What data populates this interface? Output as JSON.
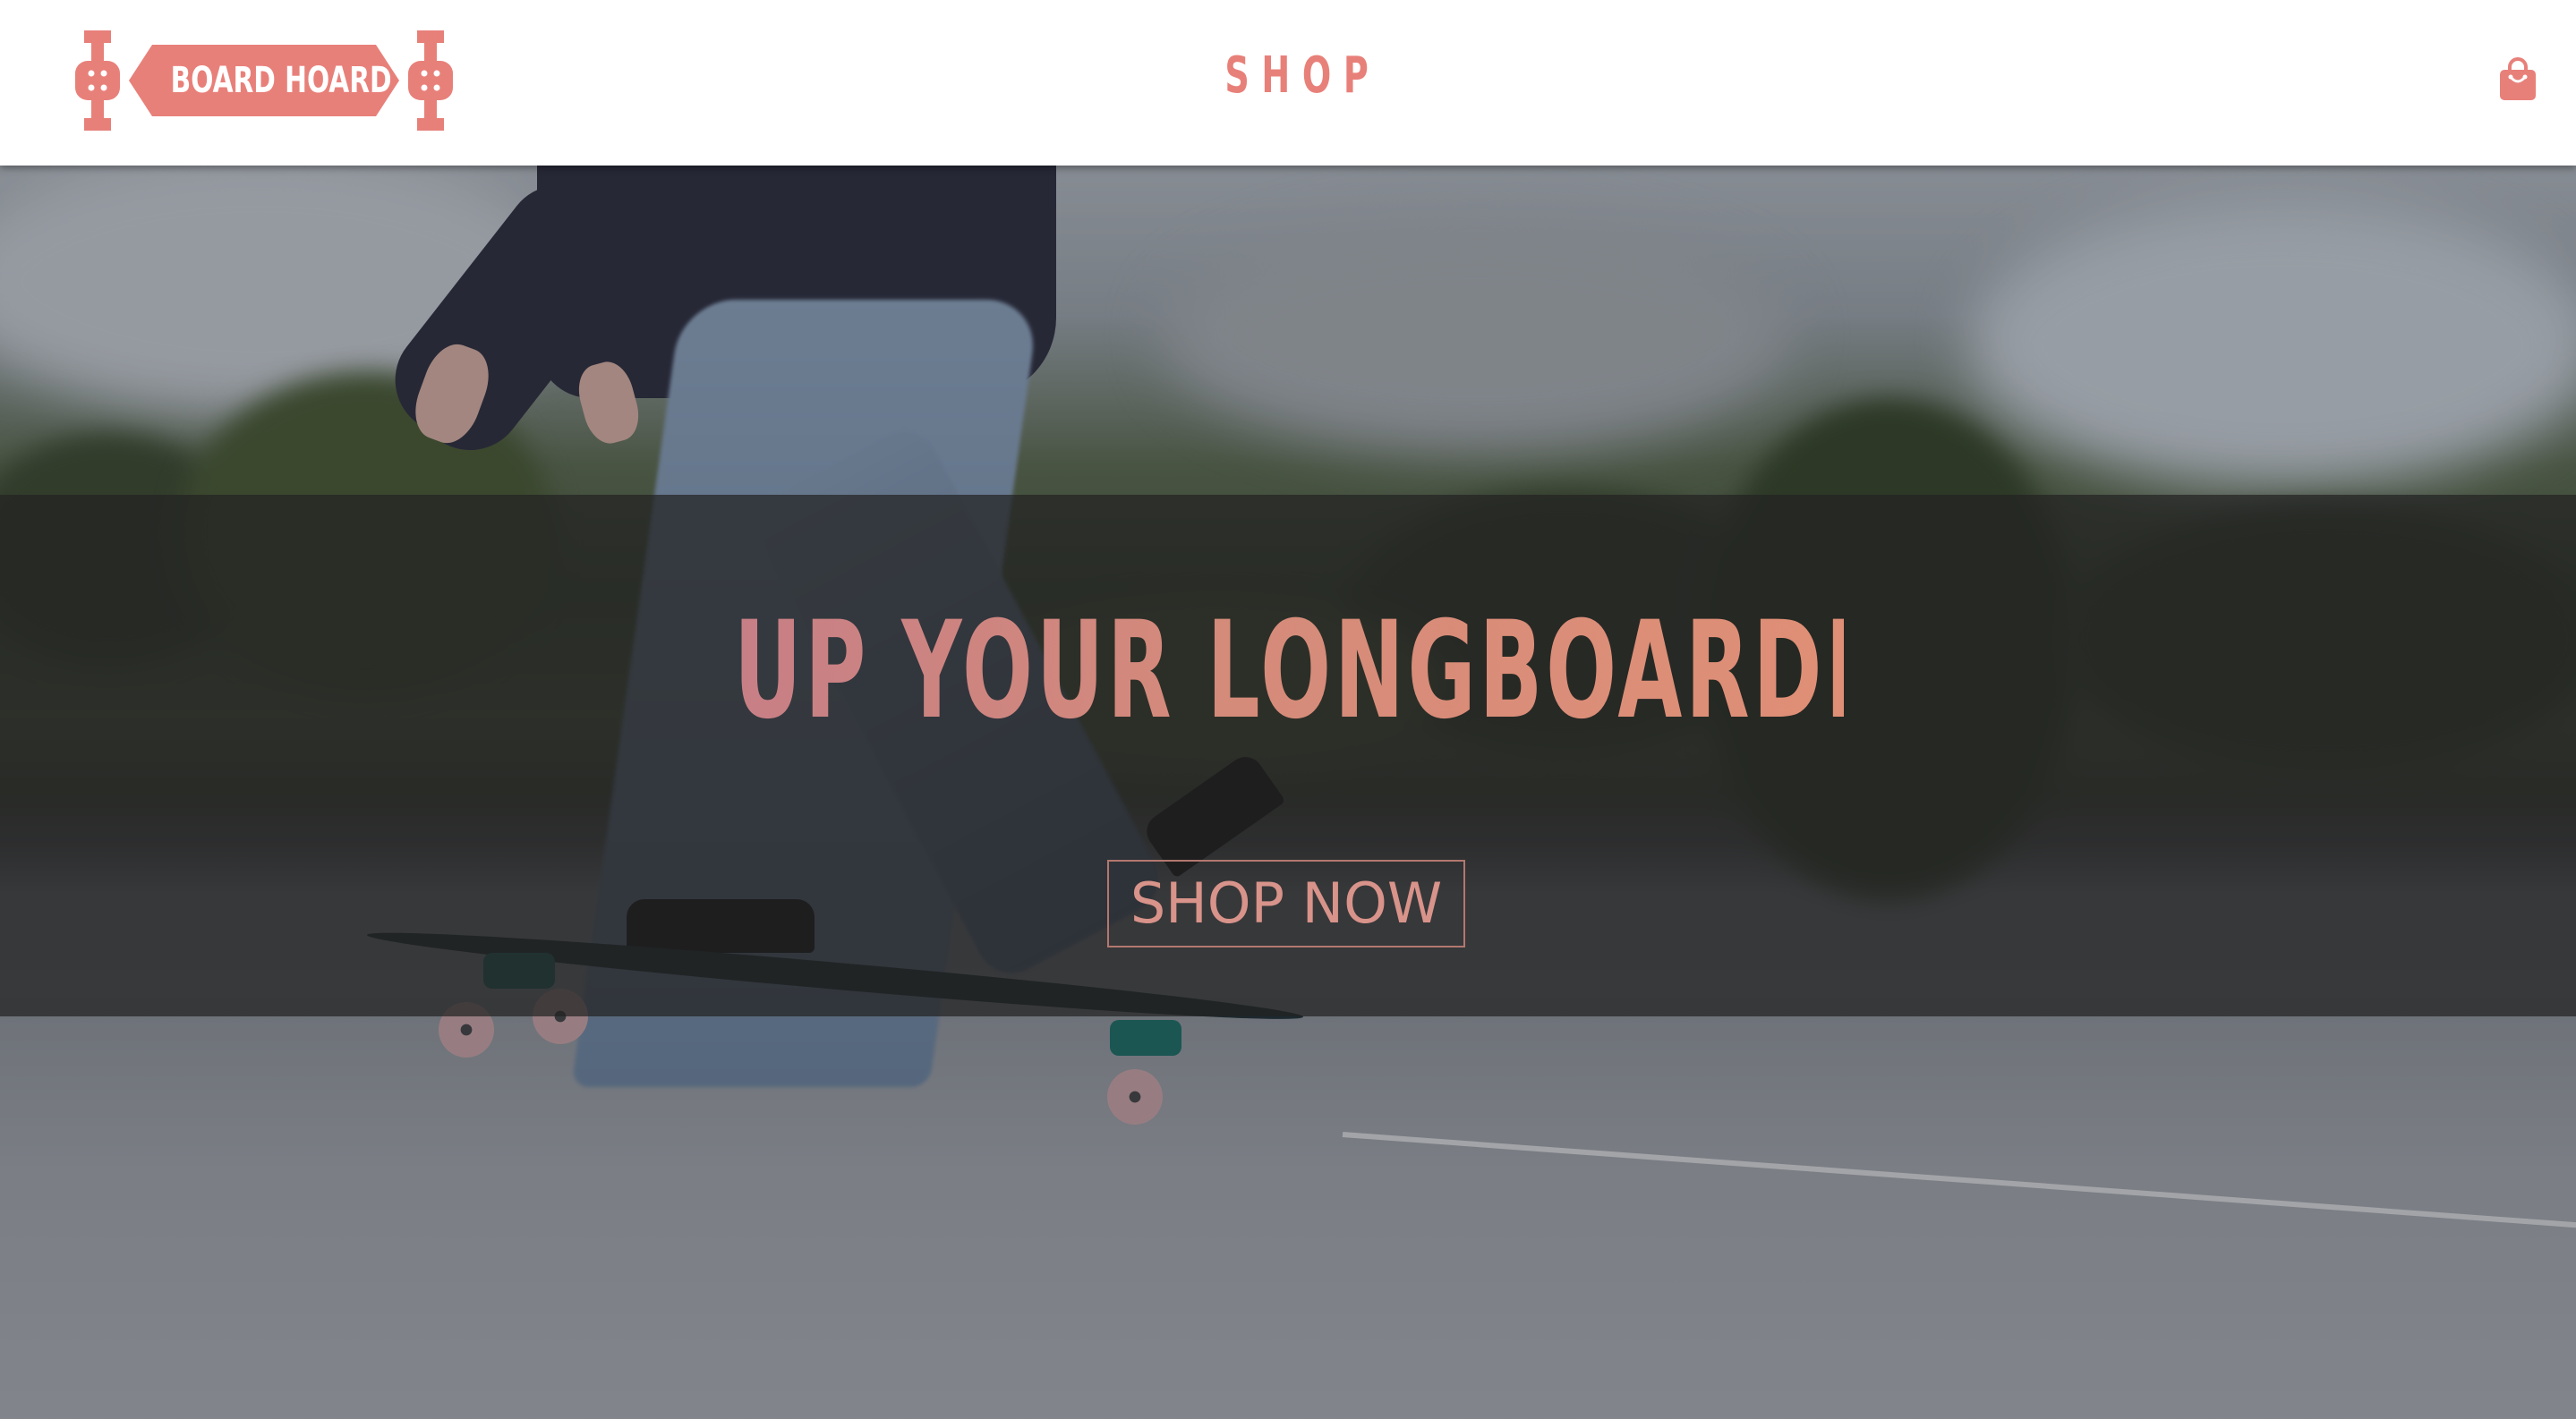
{
  "brand": {
    "logo_text": "BOARD HOARD",
    "accent_color": "#E8807A"
  },
  "nav": {
    "shop_label": "SHOP",
    "cart_icon": "shopping-bag-icon"
  },
  "hero": {
    "headline": "UP YOUR LONGBOARDING GAME",
    "cta_label": "SHOP NOW",
    "background_image": "skater-riding-longboard-on-road"
  }
}
